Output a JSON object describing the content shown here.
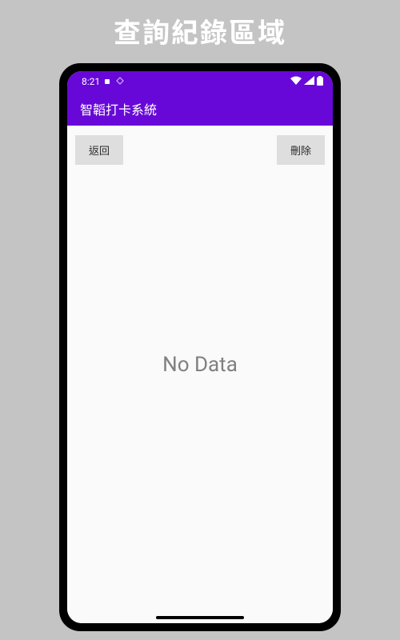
{
  "page": {
    "title": "查詢紀錄區域"
  },
  "status_bar": {
    "time": "8:21"
  },
  "app_bar": {
    "title": "智韜打卡系統"
  },
  "buttons": {
    "back_label": "返回",
    "delete_label": "刪除"
  },
  "content": {
    "empty_message": "No Data"
  },
  "colors": {
    "primary": "#6708d8",
    "background": "#c4c4c4",
    "surface": "#fafafa",
    "button": "#dedede"
  }
}
